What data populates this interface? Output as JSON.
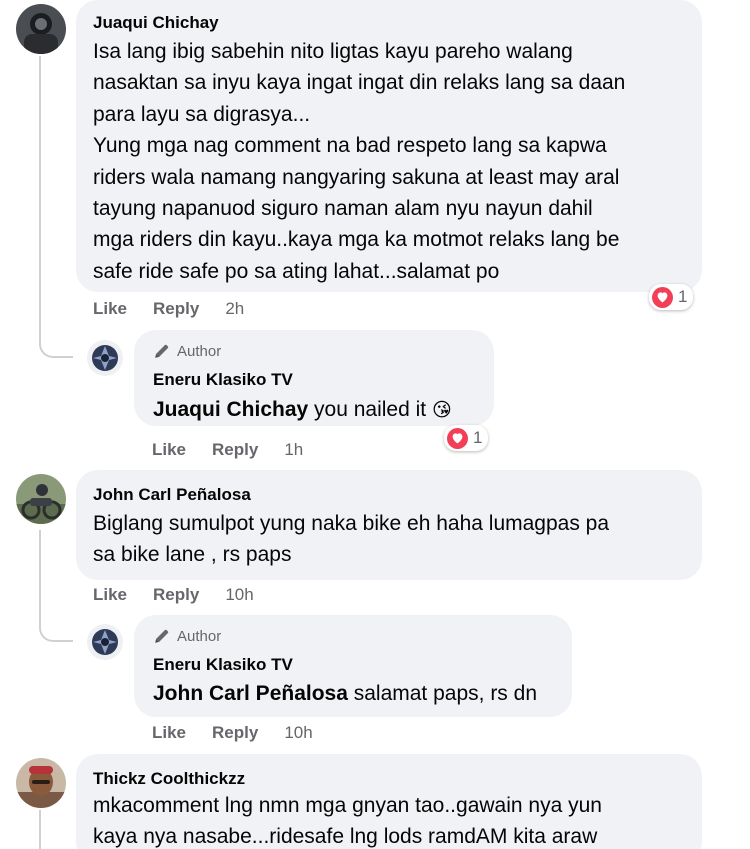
{
  "comments": [
    {
      "author": "Juaqui Chichay",
      "text_lines": [
        "Isa lang ibig sabehin nito ligtas kayu pareho walang",
        "nasaktan sa inyu kaya ingat ingat din relaks lang sa daan",
        "para layu sa digrasya...",
        "Yung mga nag comment na bad respeto lang sa kapwa",
        "riders wala namang nangyaring sakuna at least may aral",
        "tayung napanuod siguro naman alam nyu nayun dahil",
        "mga riders din kayu..kaya mga ka motmot relaks lang be",
        "safe ride safe po sa ating lahat...salamat po"
      ],
      "actions": {
        "like": "Like",
        "reply": "Reply",
        "time": "2h"
      },
      "reaction_count": "1"
    },
    {
      "badge": "Author",
      "author": "Eneru Klasiko TV",
      "mention": "Juaqui Chichay",
      "text": " you nailed it",
      "emoji": "😘",
      "actions": {
        "like": "Like",
        "reply": "Reply",
        "time": "1h"
      },
      "reaction_count": "1"
    },
    {
      "author": "John Carl Peñalosa",
      "text_lines": [
        "Biglang sumulpot yung naka bike eh haha lumagpas pa",
        "sa bike lane , rs paps"
      ],
      "actions": {
        "like": "Like",
        "reply": "Reply",
        "time": "10h"
      }
    },
    {
      "badge": "Author",
      "author": "Eneru Klasiko TV",
      "mention": "John Carl Peñalosa",
      "text": " salamat paps, rs dn",
      "actions": {
        "like": "Like",
        "reply": "Reply",
        "time": "10h"
      }
    },
    {
      "author": "Thickz Coolthickzz",
      "text_lines": [
        "mkacomment lng nmn mga gnyan tao..gawain nya yun",
        "kaya nya nasabe...ridesafe lng lods ramdAM kita araw"
      ]
    }
  ],
  "colors": {
    "bubble": "#f0f2f5",
    "meta": "#65676b",
    "heart": "#f33e58",
    "line": "#ced0d4"
  },
  "icons": [
    "heart-icon",
    "pencil-icon"
  ]
}
